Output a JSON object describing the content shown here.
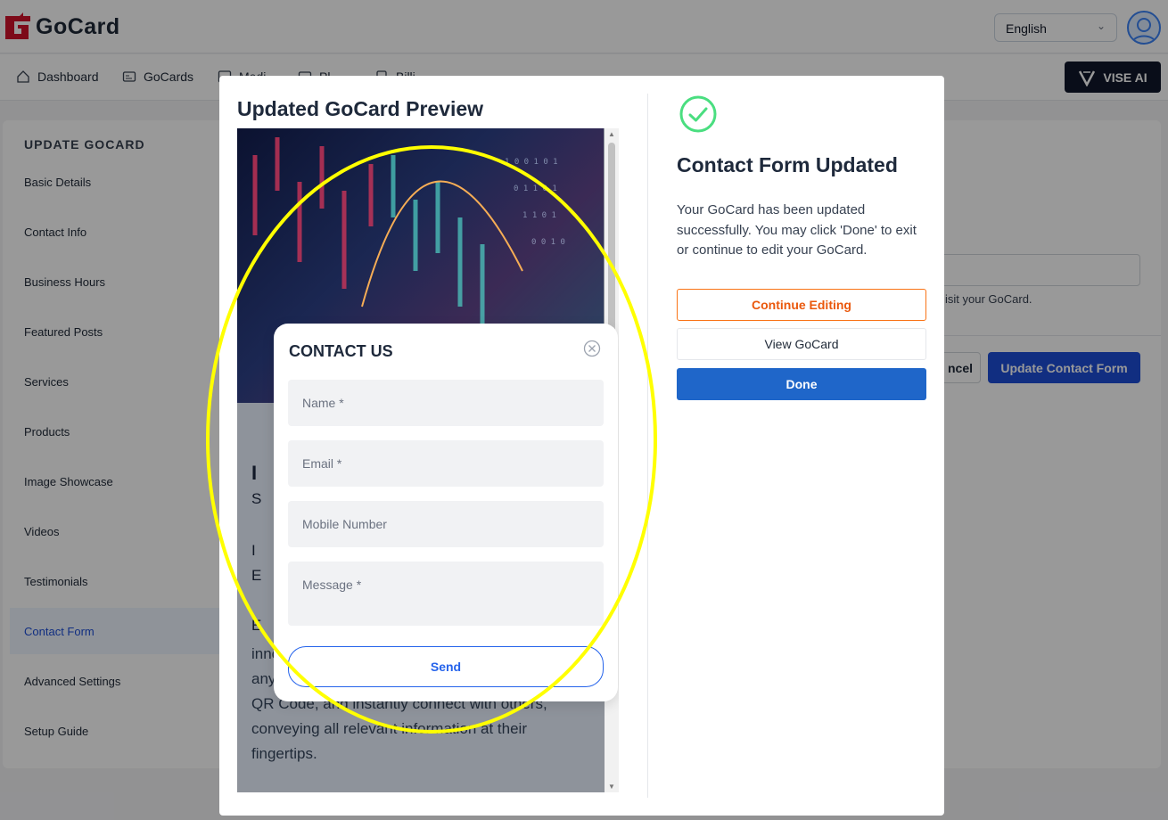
{
  "header": {
    "logo_text": "GoCard",
    "language": "English"
  },
  "nav": {
    "items": [
      {
        "label": "Dashboard",
        "icon": "home-icon"
      },
      {
        "label": "GoCards",
        "icon": "card-icon"
      },
      {
        "label": "Medi",
        "icon": "media-icon"
      },
      {
        "label": "Pl",
        "icon": "plan-icon"
      },
      {
        "label": "Billi",
        "icon": "billing-icon"
      }
    ],
    "vise_ai_label": "VISE AI"
  },
  "sidebar": {
    "title": "UPDATE GOCARD",
    "items": [
      "Basic Details",
      "Contact Info",
      "Business Hours",
      "Featured Posts",
      "Services",
      "Products",
      "Image Showcase",
      "Videos",
      "Testimonials",
      "Contact Form",
      "Advanced Settings",
      "Setup Guide"
    ],
    "active": "Contact Form"
  },
  "background_content": {
    "hint_fragment": "isit your GoCard.",
    "cancel_fragment": "ncel",
    "update_button": "Update Contact Form"
  },
  "modal": {
    "preview_title": "Updated GoCard Preview",
    "contact_form": {
      "title": "CONTACT US",
      "fields": [
        "Name *",
        "Email *",
        "Mobile Number",
        "Message *"
      ],
      "send_label": "Send"
    },
    "preview_fragments": {
      "f1": "I",
      "f2": "S",
      "f3": "I",
      "f4": "E",
      "f5": "E"
    },
    "preview_description": "innovative virtual business card, accessible anywhere, anytime. Simply share your unique QR Code, and instantly connect with others, conveying all relevant information at their fingertips.",
    "success": {
      "title": "Contact Form Updated",
      "message": "Your GoCard has been updated successfully. You may click 'Done' to exit or continue to edit your GoCard.",
      "continue_label": "Continue Editing",
      "view_label": "View GoCard",
      "done_label": "Done"
    }
  },
  "colors": {
    "brand_red": "#d0112b",
    "primary_blue": "#1f66c9",
    "orange": "#f97316",
    "success_green": "#4ade80",
    "highlight_yellow": "#ffff00"
  }
}
